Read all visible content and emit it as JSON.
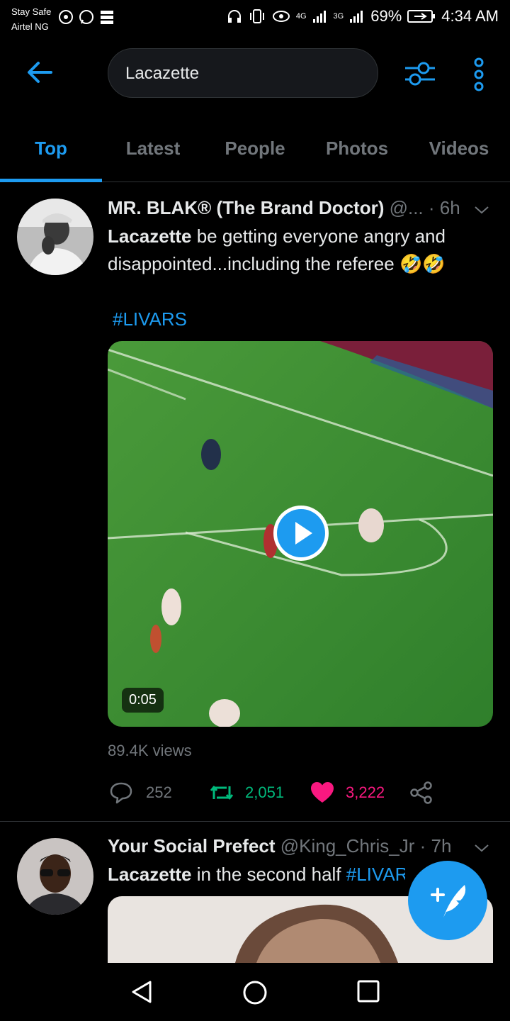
{
  "status_bar": {
    "carrier_line1": "Stay Safe",
    "carrier_line2": "Airtel NG",
    "net1": "4G",
    "net2": "3G",
    "battery": "69%",
    "time": "4:34 AM"
  },
  "search": {
    "query": "Lacazette"
  },
  "tabs": [
    {
      "label": "Top",
      "active": true
    },
    {
      "label": "Latest"
    },
    {
      "label": "People"
    },
    {
      "label": "Photos"
    },
    {
      "label": "Videos"
    }
  ],
  "tweets": [
    {
      "name": "MR. BLAK® (The Brand Doctor)",
      "handle": "@...",
      "time": "· 6h",
      "text_bold": "Lacazette",
      "text_rest": " be getting everyone angry and disappointed...including the referee 🤣🤣",
      "hashtag": "#LIVARS",
      "video_duration": "0:05",
      "views": "89.4K views",
      "replies": "252",
      "retweets": "2,051",
      "likes": "3,222"
    },
    {
      "name": "Your Social Prefect",
      "handle": "@King_Chris_Jr",
      "time": "· 7h",
      "text_bold": "Lacazette",
      "text_rest": " in the second half ",
      "hashtag": "#LIVARS"
    }
  ],
  "colors": {
    "accent": "#1d9bf0",
    "retweet": "#00ba7c",
    "like": "#f91880",
    "muted": "#71767b"
  }
}
